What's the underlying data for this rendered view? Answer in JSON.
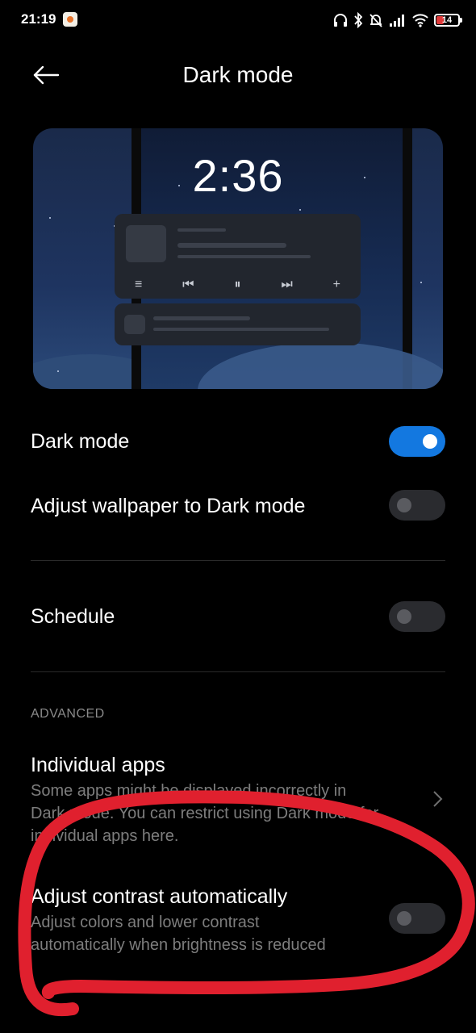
{
  "status_bar": {
    "time": "21:19",
    "battery_level": "14",
    "icons": [
      "headphones-icon",
      "bluetooth-icon",
      "alarm-off-icon",
      "signal-icon",
      "wifi-icon",
      "battery-icon"
    ]
  },
  "header": {
    "title": "Dark mode",
    "back_icon": "back-arrow-icon"
  },
  "preview": {
    "clock": "2:36",
    "media_controls": [
      "≡",
      "⏮",
      "⏸",
      "⏭",
      "+"
    ]
  },
  "settings": {
    "dark_mode": {
      "label": "Dark mode",
      "enabled": true
    },
    "adjust_wallpaper": {
      "label": "Adjust wallpaper to Dark mode",
      "enabled": false
    },
    "schedule": {
      "label": "Schedule",
      "enabled": false
    }
  },
  "advanced": {
    "header": "ADVANCED",
    "individual_apps": {
      "title": "Individual apps",
      "desc_line1": "Some apps might be displayed incorrectly in",
      "desc_line2": "Dark mode. You can restrict using Dark mode for",
      "desc_line3": "individual apps here."
    },
    "adjust_contrast": {
      "title": "Adjust contrast automatically",
      "desc_line1": "Adjust colors and lower contrast",
      "desc_line2": "automatically when brightness is reduced",
      "enabled": false
    }
  },
  "colors": {
    "accent": "#1378e0",
    "annotation": "#e0202e",
    "background": "#000000"
  }
}
